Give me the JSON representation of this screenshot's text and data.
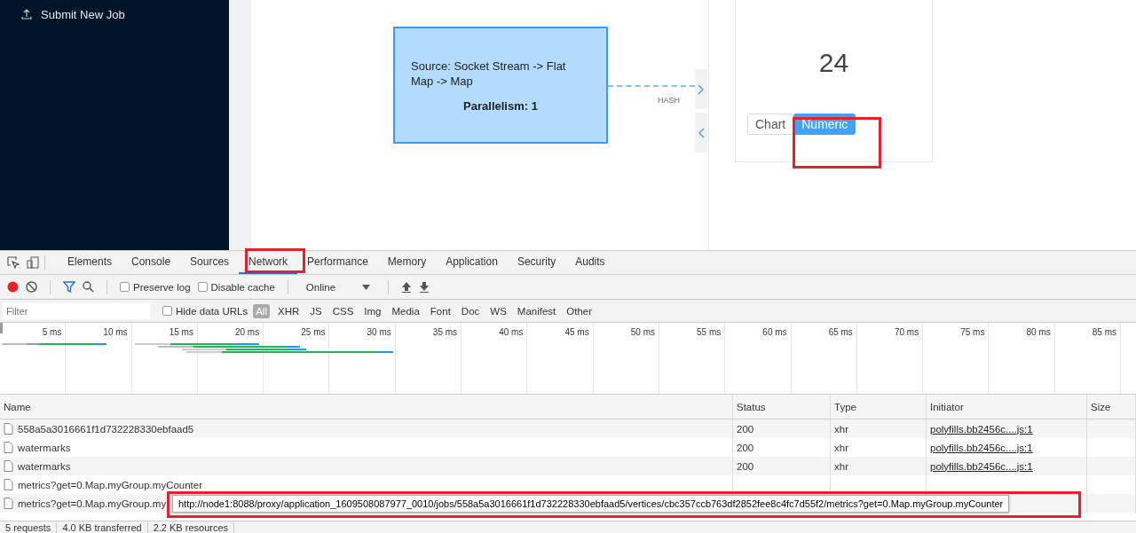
{
  "sidebar": {
    "items": [
      {
        "label": "Submit New Job"
      }
    ]
  },
  "graph": {
    "node": {
      "title": "Source: Socket Stream -> Flat Map -> Map",
      "parallelism": "Parallelism: 1"
    },
    "edge_label": "HASH"
  },
  "metric_panel": {
    "value": "24",
    "view_toggle": [
      {
        "label": "Chart",
        "selected": false
      },
      {
        "label": "Numeric",
        "selected": true
      }
    ]
  },
  "devtools": {
    "tabs": [
      {
        "label": "Elements",
        "selected": false
      },
      {
        "label": "Console",
        "selected": false
      },
      {
        "label": "Sources",
        "selected": false
      },
      {
        "label": "Network",
        "selected": true
      },
      {
        "label": "Performance",
        "selected": false
      },
      {
        "label": "Memory",
        "selected": false
      },
      {
        "label": "Application",
        "selected": false
      },
      {
        "label": "Security",
        "selected": false
      },
      {
        "label": "Audits",
        "selected": false
      }
    ],
    "toolbar": {
      "recording": true,
      "preserve_log": {
        "label": "Preserve log",
        "checked": false
      },
      "disable_cache": {
        "label": "Disable cache",
        "checked": false
      },
      "throttling": "Online"
    },
    "filter": {
      "placeholder": "Filter",
      "hide_data_urls": {
        "label": "Hide data URLs",
        "checked": false
      },
      "types": [
        {
          "label": "All",
          "selected": true
        },
        {
          "label": "XHR",
          "selected": false
        },
        {
          "label": "JS",
          "selected": false
        },
        {
          "label": "CSS",
          "selected": false
        },
        {
          "label": "Img",
          "selected": false
        },
        {
          "label": "Media",
          "selected": false
        },
        {
          "label": "Font",
          "selected": false
        },
        {
          "label": "Doc",
          "selected": false
        },
        {
          "label": "WS",
          "selected": false
        },
        {
          "label": "Manifest",
          "selected": false
        },
        {
          "label": "Other",
          "selected": false
        }
      ]
    },
    "timeline_ticks": [
      "5 ms",
      "10 ms",
      "15 ms",
      "20 ms",
      "25 ms",
      "30 ms",
      "35 ms",
      "40 ms",
      "45 ms",
      "50 ms",
      "55 ms",
      "60 ms",
      "65 ms",
      "70 ms",
      "75 ms",
      "80 ms",
      "85 ms"
    ],
    "table": {
      "columns": [
        "Name",
        "Status",
        "Type",
        "Initiator",
        "Size"
      ],
      "rows": [
        {
          "name": "558a5a3016661f1d732228330ebfaad5",
          "status": "200",
          "type": "xhr",
          "initiator": "polyfills.bb2456c....js:1"
        },
        {
          "name": "watermarks",
          "status": "200",
          "type": "xhr",
          "initiator": "polyfills.bb2456c....js:1"
        },
        {
          "name": "watermarks",
          "status": "200",
          "type": "xhr",
          "initiator": "polyfills.bb2456c....js:1"
        },
        {
          "name": "metrics?get=0.Map.myGroup.myCounter"
        },
        {
          "name": "metrics?get=0.Map.myGroup.my"
        }
      ]
    },
    "tooltip": "http://node1:8088/proxy/application_1609508087977_0010/jobs/558a5a3016661f1d732228330ebfaad5/vertices/cbc357ccb763df2852fee8c4fc7d55f2/metrics?get=0.Map.myGroup.myCounter",
    "status_bar": [
      "5 requests",
      "4.0 KB transferred",
      "2.2 KB resources"
    ]
  }
}
